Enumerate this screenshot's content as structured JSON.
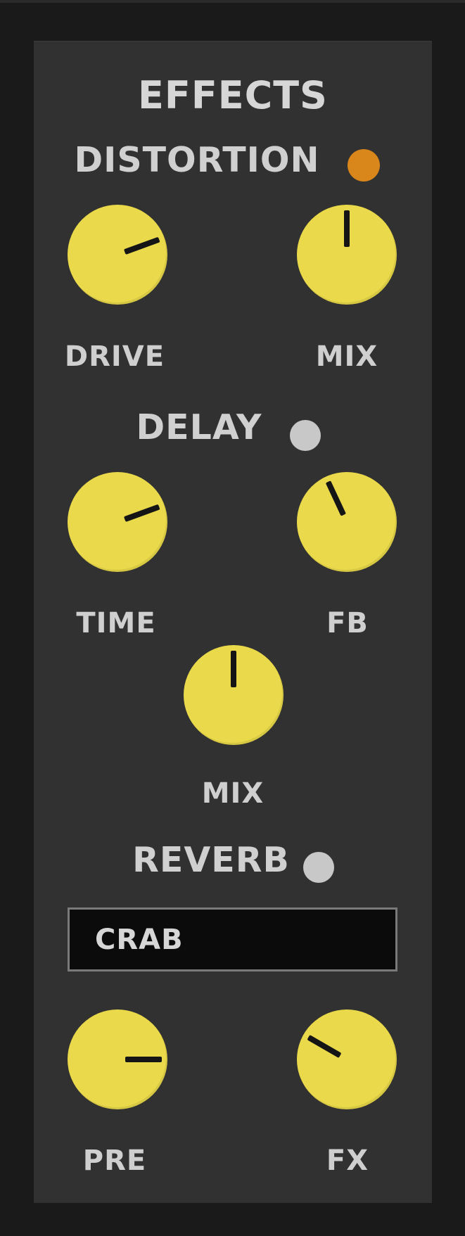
{
  "panel": {
    "title": "EFFECTS"
  },
  "distortion": {
    "label": "DISTORTION",
    "led_color": "#d9861a",
    "knobs": {
      "drive": "DRIVE",
      "mix": "MIX"
    }
  },
  "delay": {
    "label": "DELAY",
    "led_color": "#c8c8c8",
    "knobs": {
      "time": "TIME",
      "fb": "FB",
      "mix": "MIX"
    }
  },
  "reverb": {
    "label": "REVERB",
    "led_color": "#c8c8c8",
    "preset": "CRAB",
    "knobs": {
      "pre": "PRE",
      "fx": "FX"
    }
  },
  "colors": {
    "panel": "#313131",
    "knob": "#ead94a",
    "text": "#cfcfcf"
  }
}
